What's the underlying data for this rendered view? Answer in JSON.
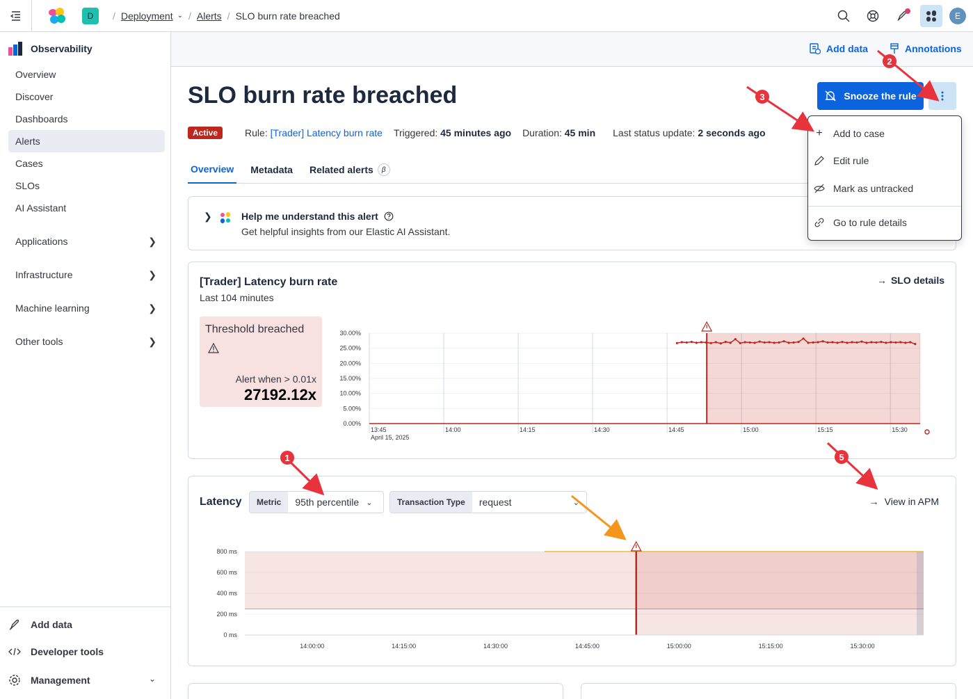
{
  "header": {
    "space_badge": "D",
    "breadcrumbs": [
      "Deployment",
      "Alerts",
      "SLO burn rate breached"
    ],
    "avatar": "E"
  },
  "sidebar": {
    "title": "Observability",
    "items": [
      {
        "label": "Overview"
      },
      {
        "label": "Discover"
      },
      {
        "label": "Dashboards"
      },
      {
        "label": "Alerts"
      },
      {
        "label": "Cases"
      },
      {
        "label": "SLOs"
      },
      {
        "label": "AI Assistant"
      },
      {
        "label": "Applications"
      },
      {
        "label": "Infrastructure"
      },
      {
        "label": "Machine learning"
      },
      {
        "label": "Other tools"
      }
    ],
    "footer": {
      "add_data": "Add data",
      "dev_tools": "Developer tools",
      "management": "Management"
    }
  },
  "subheader": {
    "add_data": "Add data",
    "annotations": "Annotations"
  },
  "alert": {
    "title": "SLO burn rate breached",
    "snooze_label": "Snooze the rule",
    "status": "Active",
    "rule_label": "Rule:",
    "rule_name": "[Trader] Latency burn rate",
    "triggered_label": "Triggered:",
    "triggered_value": "45 minutes ago",
    "duration_label": "Duration:",
    "duration_value": "45 min",
    "last_update_label": "Last status update:",
    "last_update_value": "2 seconds ago"
  },
  "tabs": [
    "Overview",
    "Metadata",
    "Related alerts"
  ],
  "tab_beta": "β",
  "ai_panel": {
    "title": "Help me understand this alert",
    "subtitle": "Get helpful insights from our Elastic AI Assistant."
  },
  "burn_panel": {
    "title": "[Trader] Latency burn rate",
    "subtitle": "Last 104 minutes",
    "slo_link": "SLO details",
    "threshold_title": "Threshold breached",
    "alert_when": "Alert when > 0.01x",
    "value": "27192.12x"
  },
  "latency_panel": {
    "title": "Latency",
    "metric_label": "Metric",
    "metric_value": "95th percentile",
    "ttype_label": "Transaction Type",
    "ttype_value": "request",
    "apm_link": "View in APM"
  },
  "actions_menu": [
    "Add to case",
    "Edit rule",
    "Mark as untracked",
    "Go to rule details"
  ],
  "annotation_numbers": [
    "1",
    "2",
    "3",
    "5"
  ],
  "colors": {
    "accent": "#0b64dd",
    "danger": "#bd271e",
    "annotation": "#e8323c",
    "arrow_orange": "#f5961c"
  },
  "chart_data": [
    {
      "type": "line",
      "title": "",
      "ylim": [
        0,
        30
      ],
      "y_unit": "%",
      "y_ticks": [
        "0.00%",
        "5.00%",
        "10.00%",
        "15.00%",
        "20.00%",
        "25.00%",
        "30.00%"
      ],
      "x_ticks": [
        "13:45",
        "14:00",
        "14:15",
        "14:30",
        "14:45",
        "15:00",
        "15:15",
        "15:30"
      ],
      "x_date_label": "April 15, 2025",
      "series": [
        {
          "values": [
            26.7,
            27.0,
            26.9,
            27.1,
            26.8,
            27.0,
            26.9,
            26.7,
            27.0,
            26.6,
            27.1,
            26.8,
            28.0,
            26.7,
            27.0,
            26.9,
            26.8,
            27.2,
            26.9,
            27.0,
            26.8,
            26.9,
            27.3,
            26.8,
            26.9,
            27.1,
            28.2,
            26.8,
            26.9,
            27.0,
            27.3,
            26.9,
            27.0,
            26.8,
            27.1,
            26.8,
            27.0,
            26.9,
            27.2,
            26.8,
            27.0,
            26.9,
            27.1,
            26.8,
            27.0,
            26.9,
            27.0,
            26.8,
            27.0,
            26.4
          ]
        }
      ],
      "series_start": "14:47",
      "series_end": "15:35",
      "alert_start": "14:53",
      "grid": true
    },
    {
      "type": "area",
      "title": "",
      "ylim": [
        0,
        800
      ],
      "y_ticks": [
        "0 ms",
        "200 ms",
        "400 ms",
        "600 ms",
        "800 ms"
      ],
      "x_ticks": [
        "14:00:00",
        "14:15:00",
        "14:30:00",
        "14:45:00",
        "15:00:00",
        "15:15:00",
        "15:30:00"
      ],
      "threshold": 250,
      "value_line": 800,
      "alert_start": "14:53",
      "grid": true
    }
  ]
}
